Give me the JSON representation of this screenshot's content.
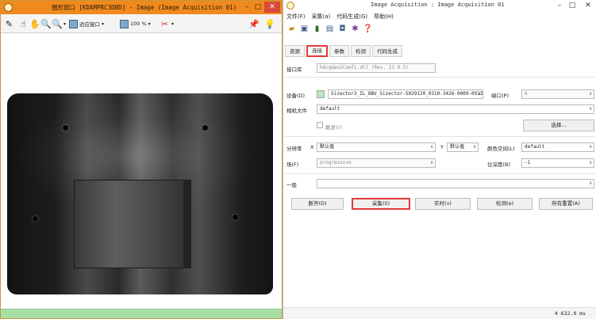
{
  "left_window": {
    "title": "图形窗口 [KDAMPRC3DBD] - Image (Image Acquisition 01)",
    "min_glyph": "–",
    "max_glyph": "□",
    "close_glyph": "✕",
    "toolbar": {
      "fit_window": "适应窗口",
      "zoom": "100 %"
    }
  },
  "right_window": {
    "title": "Image Acquisition : Image Acquisition 01",
    "min_glyph": "–",
    "max_glyph": "□",
    "close_glyph": "✕",
    "menu": [
      "文件(F)",
      "采集(a)",
      "代码生成(G)",
      "帮助(H)"
    ],
    "tabs": [
      "资源",
      "连接",
      "参数",
      "检测",
      "代码生成"
    ],
    "active_tab": "连接",
    "interface_label": "接口库",
    "interface_value": "hAcqGenICamTL.dll (Rev. 13.0.5)",
    "device_label": "设备(D)",
    "device_value": "Sizector3_IL_BBV_Sizector-S029120_0310-3426-0009-0912",
    "port_label": "端口(P)",
    "port_value": "0",
    "camera_file_label": "相机文件",
    "camera_file_value": "default",
    "trigger_label": "触发(r)",
    "select_button": "选择...",
    "resolution_label": "分辨率",
    "x_label": "X",
    "x_value": "默认值",
    "y_label": "Y",
    "y_value": "默认值",
    "color_space_label": "颜色空间(L)",
    "color_space_value": "default",
    "field_label": "场(F)",
    "field_value": "progressive",
    "bit_depth_label": "位深度(B)",
    "bit_depth_value": "-1",
    "general_label": "一般",
    "general_value": "",
    "buttons": {
      "connect": "断开(D)",
      "snap": "采集(S)",
      "live": "实时(v)",
      "detect": "检测(e)",
      "reset_all": "所有重置(A)"
    },
    "status": "4  632.0 ms"
  }
}
